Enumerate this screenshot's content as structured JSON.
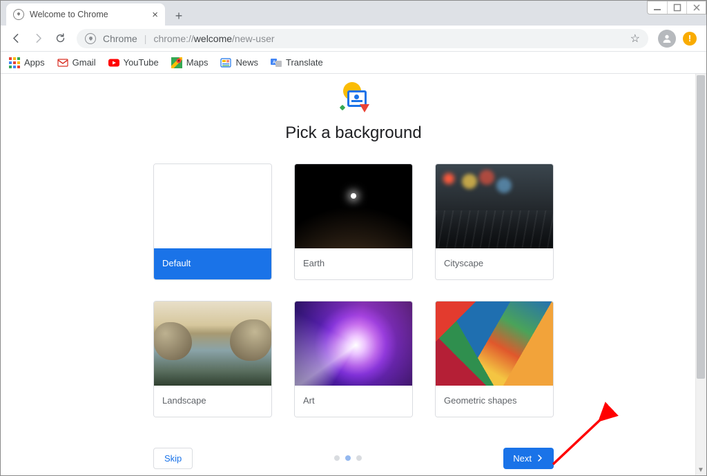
{
  "window": {
    "tab_title": "Welcome to Chrome"
  },
  "toolbar": {
    "omnibox_label": "Chrome",
    "url_prefix": "chrome://",
    "url_bold": "welcome",
    "url_suffix": "/new-user",
    "alert_glyph": "!"
  },
  "bookmarks": {
    "apps": "Apps",
    "gmail": "Gmail",
    "youtube": "YouTube",
    "maps": "Maps",
    "news": "News",
    "translate": "Translate"
  },
  "page": {
    "title": "Pick a background",
    "cards": {
      "default": "Default",
      "earth": "Earth",
      "cityscape": "Cityscape",
      "landscape": "Landscape",
      "art": "Art",
      "geometric": "Geometric shapes"
    },
    "skip": "Skip",
    "next": "Next",
    "step_active_index": 1,
    "step_count": 3
  }
}
